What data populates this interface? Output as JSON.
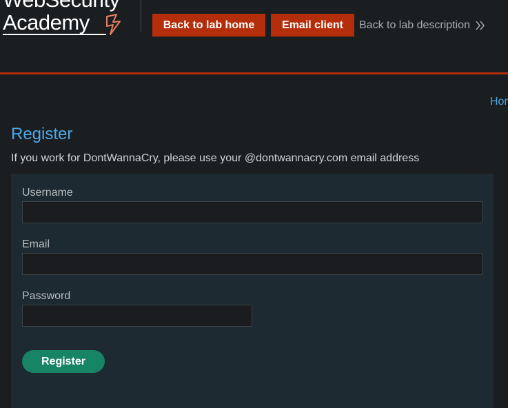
{
  "header": {
    "logo_line1": "WebSecurity",
    "logo_line2": "Academy",
    "back_to_lab_home": "Back to lab home",
    "email_client": "Email client",
    "back_to_lab_description": "Back to lab description"
  },
  "nav": {
    "home_link": "Home"
  },
  "page": {
    "title": "Register",
    "description": "If you work for DontWannaCry, please use your @dontwannacry.com email address"
  },
  "form": {
    "username_label": "Username",
    "username_value": "",
    "email_label": "Email",
    "email_value": "",
    "password_label": "Password",
    "password_value": "",
    "submit_label": "Register"
  },
  "colors": {
    "accent_orange": "#b52e0b",
    "link_blue": "#4da9e8",
    "register_green": "#168465",
    "panel_bg": "#1d2a31",
    "page_bg": "#1b1e21"
  }
}
